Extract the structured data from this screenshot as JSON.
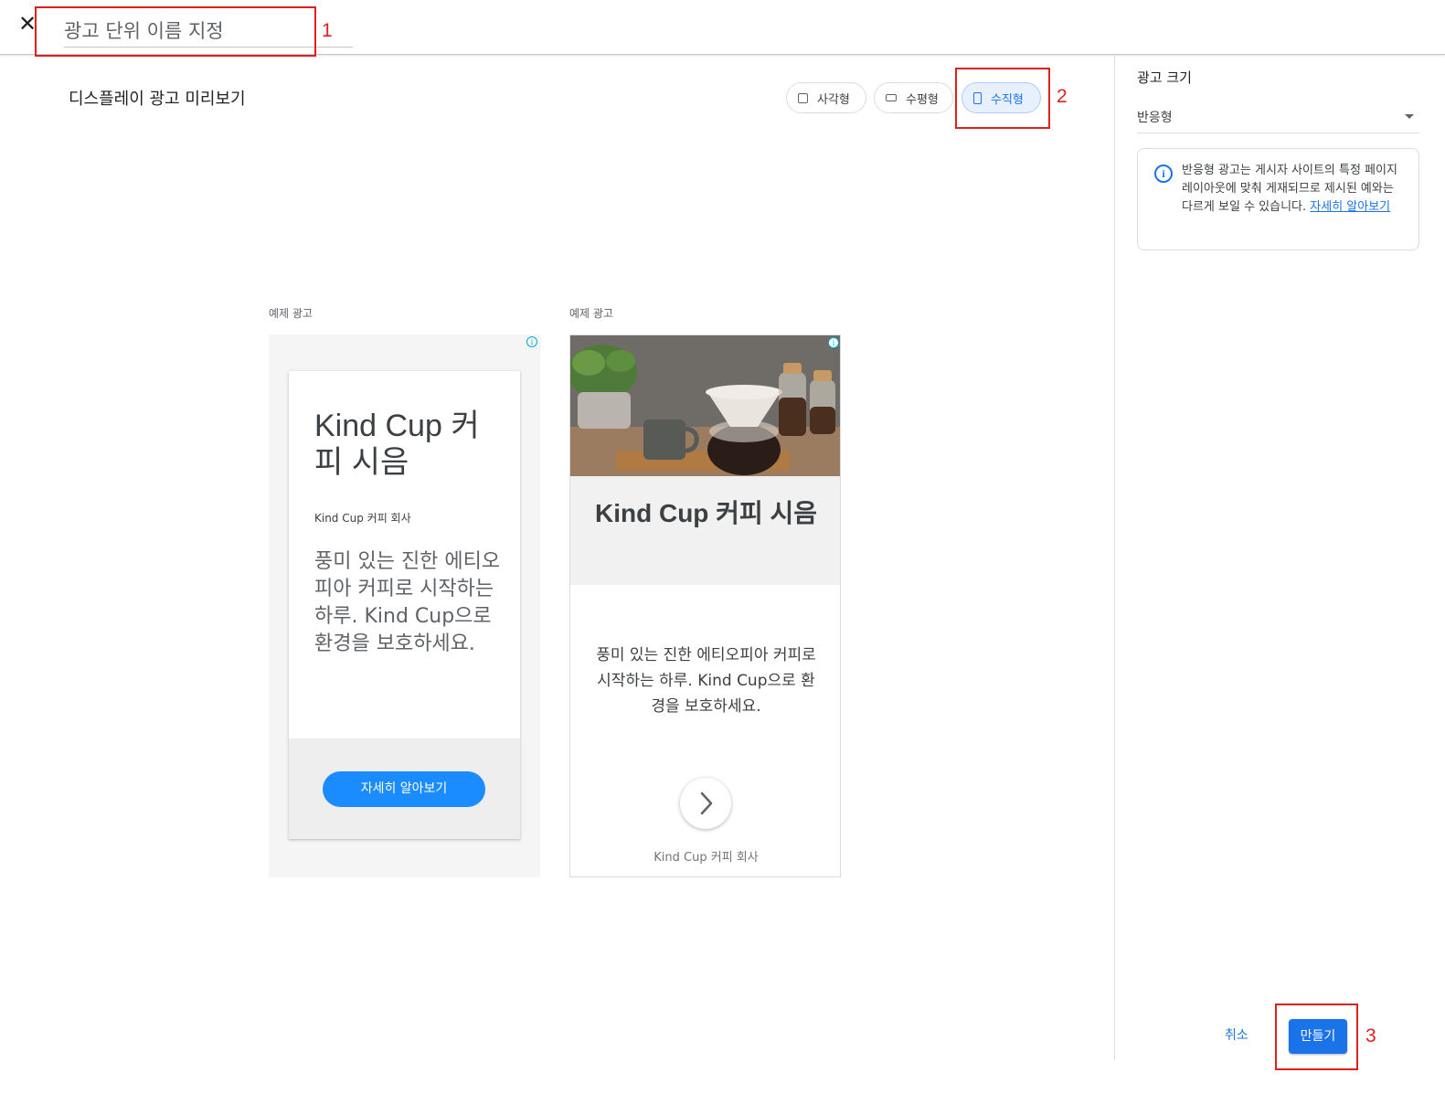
{
  "header": {
    "close_icon": "close-icon",
    "name_placeholder": "광고 단위 이름 지정"
  },
  "annotations": [
    "1",
    "2",
    "3"
  ],
  "preview": {
    "title": "디스플레이 광고 미리보기",
    "shapes": [
      {
        "label": "사각형",
        "icon": "square-icon",
        "selected": false
      },
      {
        "label": "수평형",
        "icon": "horizontal-rect-icon",
        "selected": false
      },
      {
        "label": "수직형",
        "icon": "vertical-rect-icon",
        "selected": true
      }
    ],
    "ads": [
      {
        "label": "예제 광고",
        "headline": "Kind Cup 커피 시음",
        "brand": "Kind Cup 커피 회사",
        "description": "풍미 있는 진한 에티오피아 커피로 시작하는 하루. Kind Cup으로 환경을 보호하세요.",
        "cta": "자세히 알아보기"
      },
      {
        "label": "예제 광고",
        "headline": "Kind Cup 커피 시음",
        "description": "풍미 있는 진한 에티오피아 커피로 시작하는 하루. Kind Cup으로 환경을 보호하세요.",
        "brand": "Kind Cup 커피 회사",
        "image": "coffee-photo"
      }
    ]
  },
  "sidebar": {
    "title": "광고 크기",
    "size_select": "반응형",
    "notice_text": "반응형 광고는 게시자 사이트의 특정 페이지 레이아웃에 맞춰 게재되므로 제시된 예와는 다르게 보일 수 있습니다.",
    "notice_link": "자세히 알아보기"
  },
  "footer": {
    "cancel": "취소",
    "create": "만들기"
  },
  "colors": {
    "accent": "#1a73e8",
    "annotation": "#e01f1f",
    "ad_cta": "#1a8cff"
  }
}
